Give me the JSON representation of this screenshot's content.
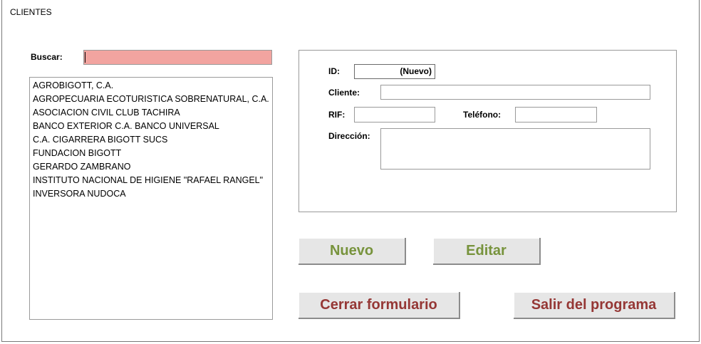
{
  "window": {
    "title": "CLIENTES"
  },
  "search": {
    "label": "Buscar:",
    "value": ""
  },
  "clients": [
    "AGROBIGOTT, C.A.",
    "AGROPECUARIA ECOTURISTICA SOBRENATURAL, C.A.",
    "ASOCIACION CIVIL CLUB TACHIRA",
    "BANCO EXTERIOR C.A. BANCO UNIVERSAL",
    "C.A. CIGARRERA BIGOTT SUCS",
    "FUNDACION BIGOTT",
    "GERARDO ZAMBRANO",
    "INSTITUTO NACIONAL DE HIGIENE \"RAFAEL RANGEL\"",
    "INVERSORA NUDOCA"
  ],
  "form": {
    "id_label": "ID:",
    "id_value": "(Nuevo)",
    "cliente_label": "Cliente:",
    "cliente_value": "",
    "rif_label": "RIF:",
    "rif_value": "",
    "telefono_label": "Teléfono:",
    "telefono_value": "",
    "direccion_label": "Dirección:",
    "direccion_value": ""
  },
  "buttons": {
    "nuevo": "Nuevo",
    "editar": "Editar",
    "cerrar": "Cerrar formulario",
    "salir": "Salir del programa"
  },
  "colors": {
    "search_bg": "#f2a4a0",
    "button_green_text": "#77933c",
    "button_red_text": "#953735",
    "button_face": "#e6e6e6"
  }
}
